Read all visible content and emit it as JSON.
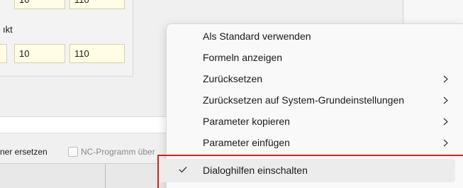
{
  "dialog": {
    "group_label": "ıkt",
    "top_row": [
      "10",
      "110"
    ],
    "row2": [
      "10",
      "110"
    ],
    "option_left": "ner ersetzen",
    "option_right": "NC-Programm über"
  },
  "context_menu": {
    "items": [
      {
        "label": "Als Standard verwenden",
        "submenu": false
      },
      {
        "label": "Formeln anzeigen",
        "submenu": false
      },
      {
        "label": "Zurücksetzen",
        "submenu": true
      },
      {
        "label": "Zurücksetzen auf System-Grundeinstellungen",
        "submenu": true
      },
      {
        "label": "Parameter kopieren",
        "submenu": true
      },
      {
        "label": "Parameter einfügen",
        "submenu": true
      },
      {
        "label": "Dialoghilfen einschalten",
        "submenu": false,
        "checked": true
      }
    ]
  },
  "colors": {
    "field_bg": "#fffde6",
    "highlight_frame": "#d32020",
    "menu_bg": "#f9f9f9"
  },
  "icons": {
    "submenu": "chevron-right-icon",
    "checked": "checkmark-icon"
  }
}
